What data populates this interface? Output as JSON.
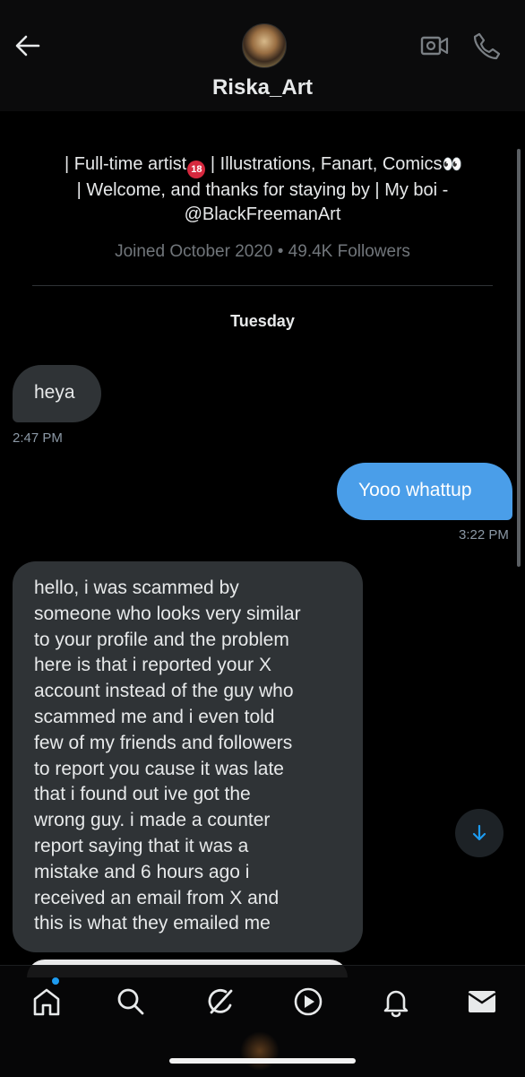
{
  "header": {
    "contact_name": "Riska_Art",
    "icons": {
      "back": "arrow-left-icon",
      "video": "video-camera-icon",
      "call": "phone-icon"
    }
  },
  "profile": {
    "bio_line1_a": "| Full-time artist",
    "bio_badge": "18",
    "bio_line1_b": " | Illustrations, Fanart, Comics",
    "bio_eyes": "👀",
    "bio_line2": "| Welcome, and thanks for staying by | My boi -",
    "bio_line3": "@BlackFreemanArt",
    "meta": "Joined October 2020 • 49.4K Followers"
  },
  "conversation": {
    "day_label": "Tuesday",
    "messages": [
      {
        "sender": "them",
        "text": "heya",
        "time": "2:47 PM"
      },
      {
        "sender": "me",
        "text": "Yooo whattup",
        "time": "3:22 PM"
      },
      {
        "sender": "them",
        "lines": [
          "hello, i was scammed by",
          "someone who looks very similar",
          "to your profile and the problem",
          "here is that i reported your X",
          "account instead of the guy who",
          "scammed me and i even told",
          "few of my friends and followers",
          "to report you cause it was late",
          "that i found out ive got the",
          "wrong guy. i made a counter",
          "report saying that it was a",
          "mistake and 6 hours ago i",
          "received an email from X and",
          "this is what they emailed me"
        ]
      }
    ]
  },
  "nav": {
    "items": [
      "home-icon",
      "search-icon",
      "grok-icon",
      "play-icon",
      "bell-icon",
      "mail-icon"
    ],
    "active": "mail-icon"
  },
  "colors": {
    "accent": "#1d9bf0",
    "outgoing_bubble": "#4a9ee9",
    "incoming_bubble": "#2f3336",
    "background": "#000000"
  }
}
